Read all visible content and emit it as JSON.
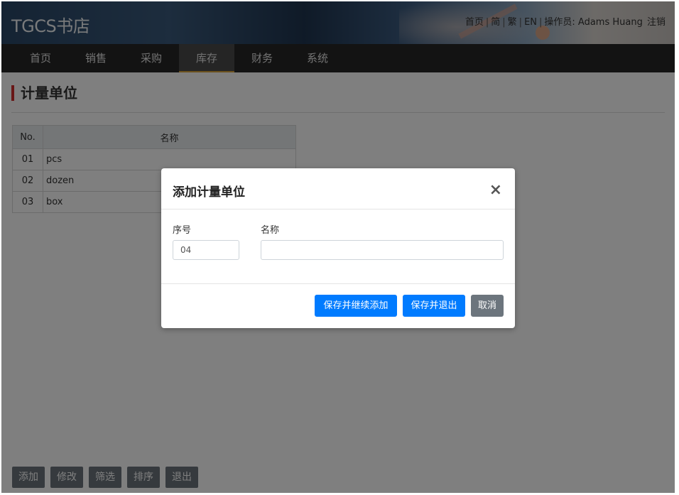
{
  "header": {
    "brand": "TGCS书店",
    "links": {
      "home": "首页",
      "simplified": "简",
      "traditional": "繁",
      "english": "EN",
      "operator": "操作员: Adams Huang",
      "logout": "注销"
    },
    "separator": "|"
  },
  "nav": {
    "items": [
      {
        "label": "首页"
      },
      {
        "label": "销售"
      },
      {
        "label": "采购"
      },
      {
        "label": "库存"
      },
      {
        "label": "财务"
      },
      {
        "label": "系统"
      }
    ],
    "active_index": 3
  },
  "page": {
    "title": "计量单位"
  },
  "table": {
    "headers": [
      "No.",
      "名称"
    ],
    "rows": [
      {
        "no": "01",
        "name": "pcs"
      },
      {
        "no": "02",
        "name": "dozen"
      },
      {
        "no": "03",
        "name": "box"
      }
    ]
  },
  "bottom_buttons": [
    "添加",
    "修改",
    "筛选",
    "排序",
    "退出"
  ],
  "modal": {
    "title": "添加计量单位",
    "close": "×",
    "fields": {
      "seq_label": "序号",
      "seq_value": "04",
      "name_label": "名称",
      "name_value": ""
    },
    "buttons": {
      "save_continue": "保存并继续添加",
      "save_exit": "保存并退出",
      "cancel": "取消"
    }
  },
  "colors": {
    "accent": "#007bff",
    "secondary": "#6c757d",
    "nav_bg": "#262626",
    "title_bar": "#d32f2f"
  }
}
